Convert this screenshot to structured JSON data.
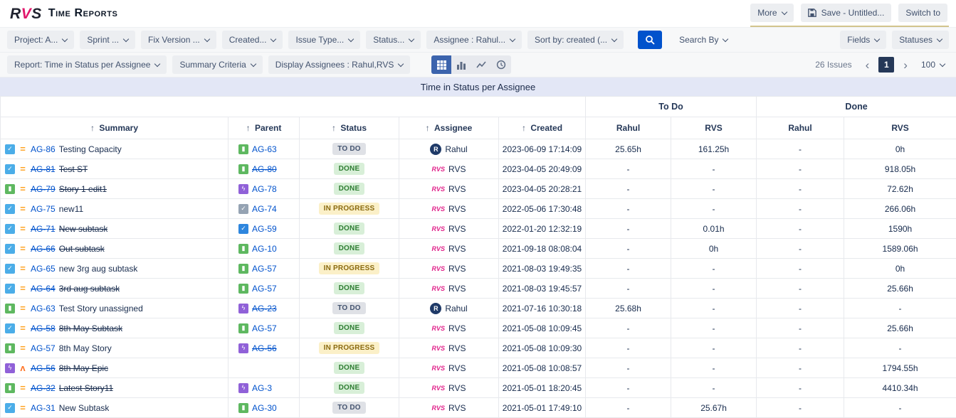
{
  "app": {
    "logo": "RVS",
    "title": "Time Reports"
  },
  "header_actions": {
    "more": "More",
    "save": "Save - Untitled...",
    "switch_to": "Switch to"
  },
  "filter_bar": {
    "filters": [
      {
        "name": "project-filter",
        "label": "Project: A..."
      },
      {
        "name": "sprint-filter",
        "label": "Sprint ..."
      },
      {
        "name": "fix-version-filter",
        "label": "Fix Version ..."
      },
      {
        "name": "created-filter",
        "label": "Created..."
      },
      {
        "name": "issue-type-filter",
        "label": "Issue Type..."
      },
      {
        "name": "status-filter",
        "label": "Status..."
      },
      {
        "name": "assignee-filter",
        "label": "Assignee : Rahul..."
      },
      {
        "name": "sort-by-filter",
        "label": "Sort by: created (..."
      }
    ],
    "search_by_label": "Search By",
    "fields_label": "Fields",
    "statuses_label": "Statuses"
  },
  "report_bar": {
    "report_label": "Report: Time in Status per Assignee",
    "summary_criteria_label": "Summary Criteria",
    "display_assignees_label": "Display Assignees : Rahul,RVS",
    "issues_count": "26 Issues",
    "current_page": "1",
    "page_size": "100"
  },
  "report_title": "Time in Status per Assignee",
  "table": {
    "group_columns": [
      {
        "label": "To Do"
      },
      {
        "label": "Done"
      }
    ],
    "columns": [
      {
        "label": "Summary",
        "sortable": true
      },
      {
        "label": "Parent",
        "sortable": true
      },
      {
        "label": "Status",
        "sortable": true
      },
      {
        "label": "Assignee",
        "sortable": true
      },
      {
        "label": "Created",
        "sortable": true
      },
      {
        "label": "Rahul"
      },
      {
        "label": "RVS"
      },
      {
        "label": "Rahul"
      },
      {
        "label": "RVS"
      }
    ],
    "rows": [
      {
        "key": "AG-86",
        "struck": false,
        "type": "subtask",
        "priority": "medium",
        "summary": "Testing Capacity",
        "parent": {
          "key": "AG-63",
          "type": "story",
          "struck": false
        },
        "status": "TO DO",
        "assignee": "Rahul",
        "created": "2023-06-09 17:14:09",
        "hours": [
          "25.65h",
          "161.25h",
          "-",
          "0h"
        ]
      },
      {
        "key": "AG-81",
        "struck": true,
        "type": "subtask",
        "priority": "medium",
        "summary": "Test ST",
        "parent": {
          "key": "AG-80",
          "type": "story",
          "struck": true
        },
        "status": "DONE",
        "assignee": "RVS",
        "created": "2023-04-05 20:49:09",
        "hours": [
          "-",
          "-",
          "-",
          "918.05h"
        ]
      },
      {
        "key": "AG-79",
        "struck": true,
        "type": "story",
        "priority": "medium",
        "summary": "Story 1 edit1",
        "parent": {
          "key": "AG-78",
          "type": "epic",
          "struck": false
        },
        "status": "DONE",
        "assignee": "RVS",
        "created": "2023-04-05 20:28:21",
        "hours": [
          "-",
          "-",
          "-",
          "72.62h"
        ]
      },
      {
        "key": "AG-75",
        "struck": false,
        "type": "subtask",
        "priority": "medium",
        "summary": "new11",
        "parent": {
          "key": "AG-74",
          "type": "task-grey",
          "struck": false
        },
        "status": "IN PROGRESS",
        "assignee": "RVS",
        "created": "2022-05-06 17:30:48",
        "hours": [
          "-",
          "-",
          "-",
          "266.06h"
        ]
      },
      {
        "key": "AG-71",
        "struck": true,
        "type": "subtask",
        "priority": "medium",
        "summary": "New subtask",
        "parent": {
          "key": "AG-59",
          "type": "task",
          "struck": false
        },
        "status": "DONE",
        "assignee": "RVS",
        "created": "2022-01-20 12:32:19",
        "hours": [
          "-",
          "0.01h",
          "-",
          "1590h"
        ]
      },
      {
        "key": "AG-66",
        "struck": true,
        "type": "subtask",
        "priority": "medium",
        "summary": "Out subtask",
        "parent": {
          "key": "AG-10",
          "type": "story",
          "struck": false
        },
        "status": "DONE",
        "assignee": "RVS",
        "created": "2021-09-18 08:08:04",
        "hours": [
          "-",
          "0h",
          "-",
          "1589.06h"
        ]
      },
      {
        "key": "AG-65",
        "struck": false,
        "type": "subtask",
        "priority": "medium",
        "summary": "new 3rg aug subtask",
        "parent": {
          "key": "AG-57",
          "type": "story",
          "struck": false
        },
        "status": "IN PROGRESS",
        "assignee": "RVS",
        "created": "2021-08-03 19:49:35",
        "hours": [
          "-",
          "-",
          "-",
          "0h"
        ]
      },
      {
        "key": "AG-64",
        "struck": true,
        "type": "subtask",
        "priority": "medium",
        "summary": "3rd aug subtask",
        "parent": {
          "key": "AG-57",
          "type": "story",
          "struck": false
        },
        "status": "DONE",
        "assignee": "RVS",
        "created": "2021-08-03 19:45:57",
        "hours": [
          "-",
          "-",
          "-",
          "25.66h"
        ]
      },
      {
        "key": "AG-63",
        "struck": false,
        "type": "story",
        "priority": "medium",
        "summary": "Test Story unassigned",
        "parent": {
          "key": "AG-23",
          "type": "epic",
          "struck": true
        },
        "status": "TO DO",
        "assignee": "Rahul",
        "created": "2021-07-16 10:30:18",
        "hours": [
          "25.68h",
          "-",
          "-",
          "-"
        ]
      },
      {
        "key": "AG-58",
        "struck": true,
        "type": "subtask",
        "priority": "medium",
        "summary": "8th May Subtask",
        "parent": {
          "key": "AG-57",
          "type": "story",
          "struck": false
        },
        "status": "DONE",
        "assignee": "RVS",
        "created": "2021-05-08 10:09:45",
        "hours": [
          "-",
          "-",
          "-",
          "25.66h"
        ]
      },
      {
        "key": "AG-57",
        "struck": false,
        "type": "story",
        "priority": "medium",
        "summary": "8th May Story",
        "parent": {
          "key": "AG-56",
          "type": "epic",
          "struck": true
        },
        "status": "IN PROGRESS",
        "assignee": "RVS",
        "created": "2021-05-08 10:09:30",
        "hours": [
          "-",
          "-",
          "-",
          "-"
        ]
      },
      {
        "key": "AG-56",
        "struck": true,
        "type": "epic",
        "priority": "high",
        "summary": "8th May Epic",
        "parent": null,
        "status": "DONE",
        "assignee": "RVS",
        "created": "2021-05-08 10:08:57",
        "hours": [
          "-",
          "-",
          "-",
          "1794.55h"
        ]
      },
      {
        "key": "AG-32",
        "struck": true,
        "type": "story",
        "priority": "medium",
        "summary": "Latest Story11",
        "parent": {
          "key": "AG-3",
          "type": "epic",
          "struck": false
        },
        "status": "DONE",
        "assignee": "RVS",
        "created": "2021-05-01 18:20:45",
        "hours": [
          "-",
          "-",
          "-",
          "4410.34h"
        ]
      },
      {
        "key": "AG-31",
        "struck": false,
        "type": "subtask",
        "priority": "medium",
        "summary": "New Subtask",
        "parent": {
          "key": "AG-30",
          "type": "story",
          "struck": false
        },
        "status": "TO DO",
        "assignee": "RVS",
        "created": "2021-05-01 17:49:10",
        "hours": [
          "-",
          "25.67h",
          "-",
          "-"
        ]
      }
    ]
  },
  "icon_map": {
    "sort_arrow": "↑",
    "issue_types": {
      "story": {
        "color": "#5eb860",
        "glyph": "▮"
      },
      "epic": {
        "color": "#9061d8",
        "glyph": "ϟ"
      },
      "subtask": {
        "color": "#4bade8",
        "glyph": "✓"
      },
      "task": {
        "color": "#2e86de",
        "glyph": "✓"
      },
      "task-grey": {
        "color": "#95a3b3",
        "glyph": "✓"
      }
    },
    "priorities": {
      "medium": {
        "glyph": "=",
        "color": "#ff9f1a"
      },
      "high": {
        "glyph": "ʌ",
        "color": "#ff7426"
      }
    },
    "statuses": {
      "TO DO": {
        "bg": "#dfe1e6",
        "fg": "#44546f"
      },
      "DONE": {
        "bg": "#d8efd8",
        "fg": "#2e7d32"
      },
      "IN PROGRESS": {
        "bg": "#fbf0c8",
        "fg": "#8a6a0f"
      }
    },
    "assignees": {
      "Rahul": {
        "kind": "avatar",
        "color": "#1f3a68"
      },
      "RVS": {
        "kind": "logo",
        "color": "#e0218a"
      }
    },
    "brand_accent": "#e1186c",
    "search_button_color": "#0052cc"
  }
}
